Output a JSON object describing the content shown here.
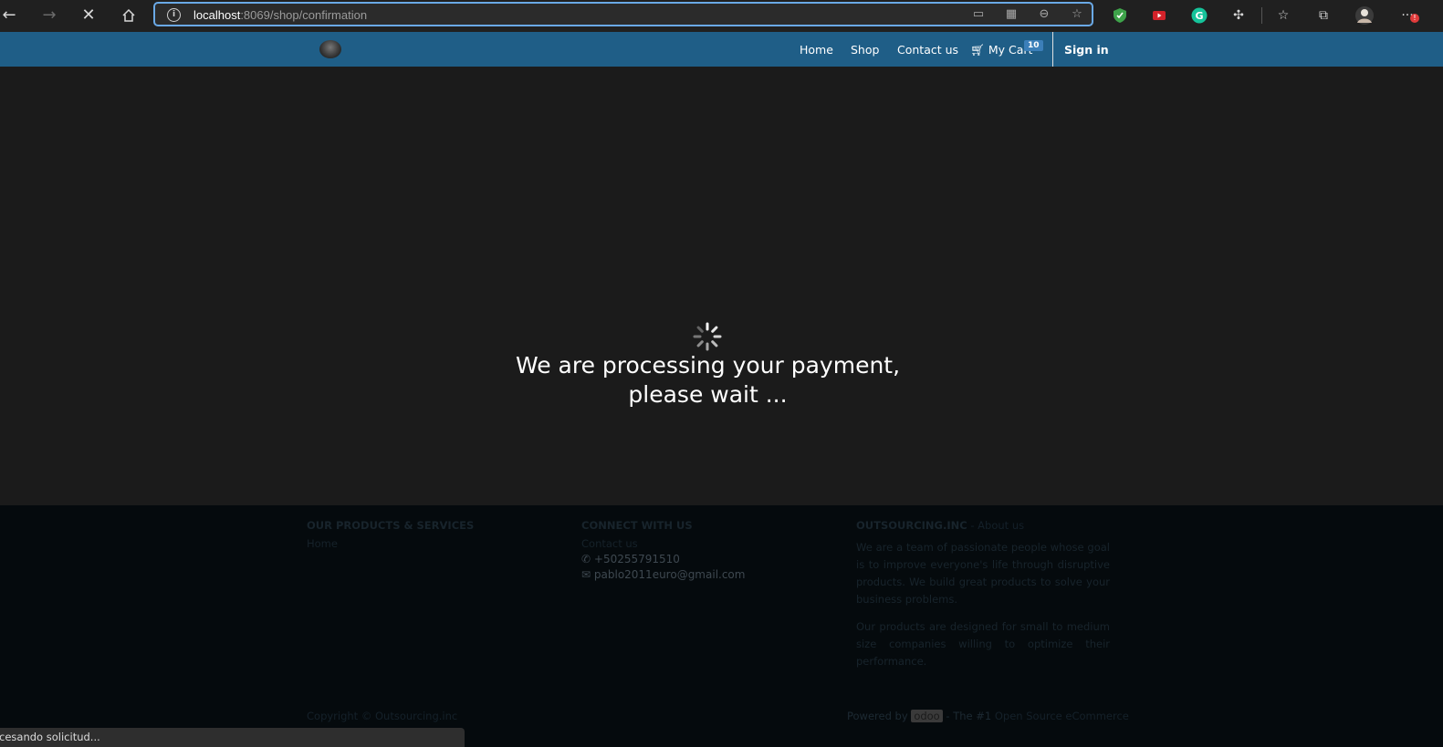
{
  "browser": {
    "url_host": "localhost",
    "url_path": ":8069/shop/confirmation",
    "status_text": "ocesando solicitud..."
  },
  "navbar": {
    "links": [
      "Home",
      "Shop",
      "Contact us"
    ],
    "cart_label": "My Cart",
    "cart_count": "10",
    "signin": "Sign in"
  },
  "main": {
    "message_line1": "We are processing your payment,",
    "message_line2": "please wait ..."
  },
  "footer": {
    "products_heading": "OUR PRODUCTS & SERVICES",
    "products_link": "Home",
    "connect_heading": "CONNECT WITH US",
    "connect_link": "Contact us",
    "phone": "+50255791510",
    "email": "pablo2011euro@gmail.com",
    "about_heading": "OUTSOURCING.INC",
    "about_heading_suffix": " - About us",
    "about_p1": "We are a team of passionate people whose goal is to improve everyone's life through disruptive products. We build great products to solve your business problems.",
    "about_p2": "Our products are designed for small to medium size companies willing to optimize their performance.",
    "copyright": "Copyright © Outsourcing.inc",
    "powered_by": "Powered by",
    "powered_pill": "odoo",
    "powered_mid": " - The #1 ",
    "powered_link": "Open Source eCommerce"
  },
  "colors": {
    "navbar": "#1f5e87",
    "page_bg": "#1b1b1b",
    "footer_bg": "#050a0d",
    "address_border": "#6aa9e6"
  }
}
